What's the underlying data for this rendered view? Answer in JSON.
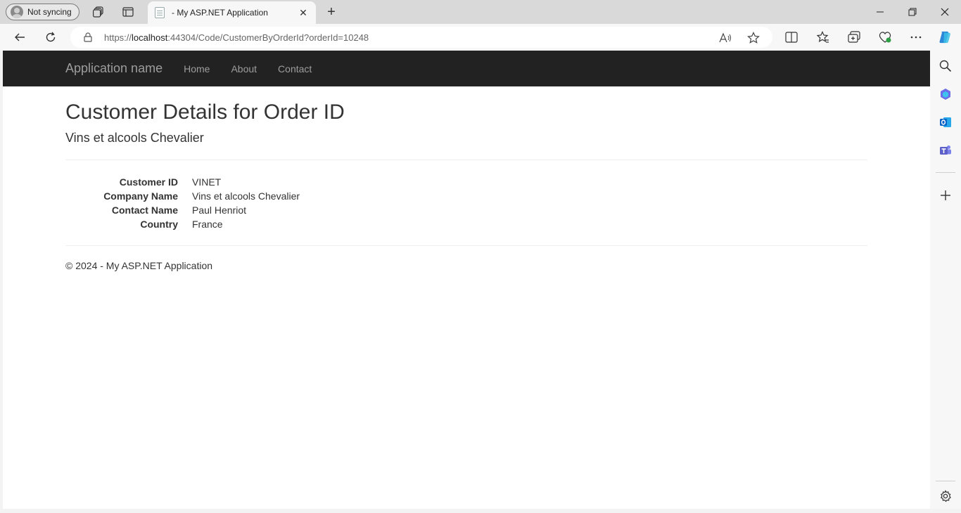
{
  "browser": {
    "profile_label": "Not syncing",
    "tab_title": "- My ASP.NET Application",
    "url_proto": "https://",
    "url_host": "localhost",
    "url_path": ":44304/Code/CustomerByOrderId?orderId=10248"
  },
  "site": {
    "brand": "Application name",
    "nav": [
      "Home",
      "About",
      "Contact"
    ]
  },
  "page": {
    "title": "Customer Details for Order ID",
    "subtitle": "Vins et alcools Chevalier",
    "details": [
      {
        "label": "Customer ID",
        "value": "VINET"
      },
      {
        "label": "Company Name",
        "value": "Vins et alcools Chevalier"
      },
      {
        "label": "Contact Name",
        "value": "Paul Henriot"
      },
      {
        "label": "Country",
        "value": "France"
      }
    ],
    "footer": "© 2024 - My ASP.NET Application"
  },
  "colors": {
    "navbar": "#222222",
    "nav_text": "#9d9d9d",
    "outlook": "#0a64c8",
    "teams": "#5b5fc7",
    "copilot": "#2b88d8"
  }
}
